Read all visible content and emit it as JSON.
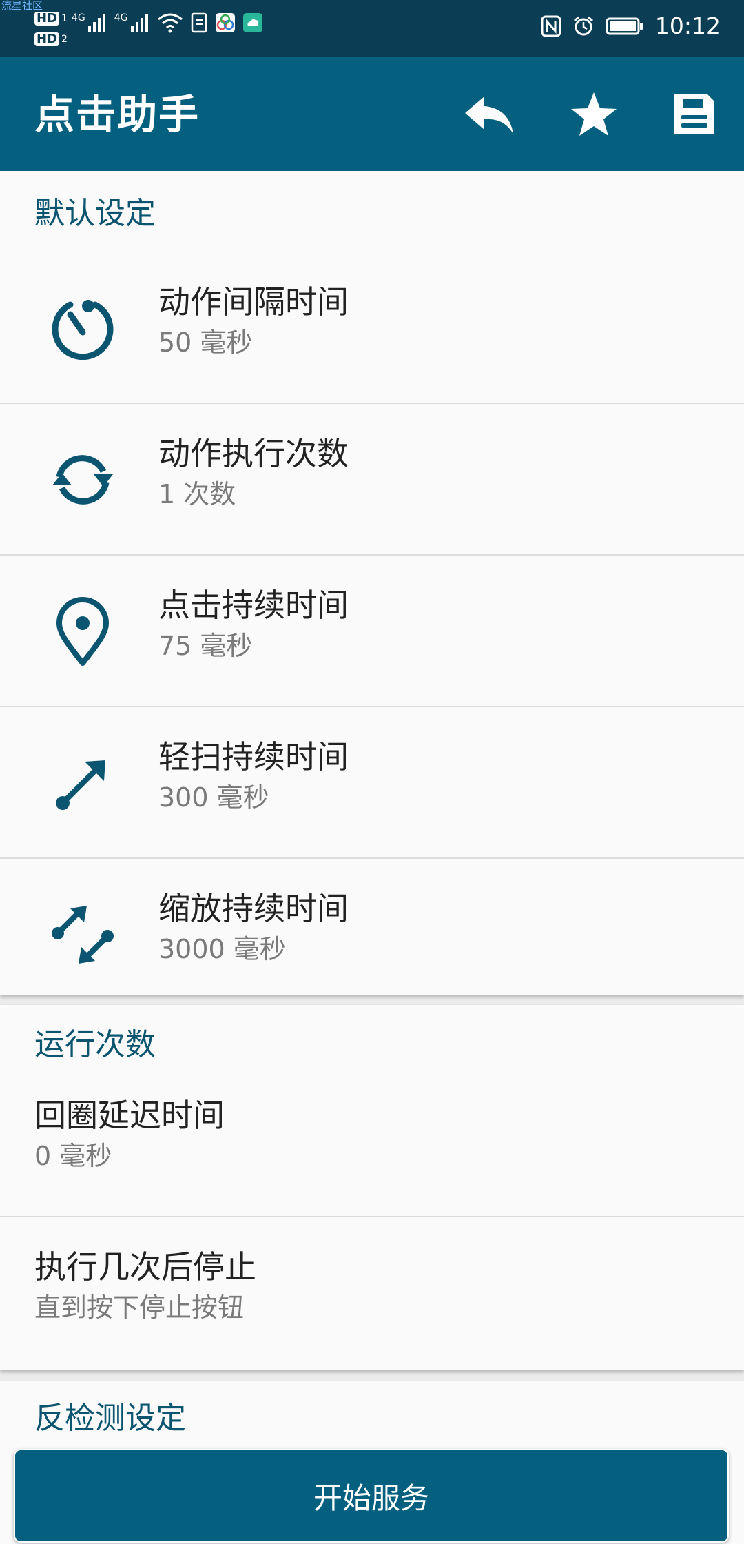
{
  "status_bar": {
    "watermark": "流星社区",
    "sim1": "HD",
    "sim1_index": "1",
    "sim2": "HD",
    "sim2_index": "2",
    "network1": "4G",
    "network2": "4G",
    "time": "10:12"
  },
  "app_bar": {
    "title": "点击助手"
  },
  "sections": {
    "default_settings": {
      "header": "默认设定",
      "items": [
        {
          "title": "动作间隔时间",
          "value": "50 毫秒"
        },
        {
          "title": "动作执行次数",
          "value": "1 次数"
        },
        {
          "title": "点击持续时间",
          "value": "75 毫秒"
        },
        {
          "title": "轻扫持续时间",
          "value": "300 毫秒"
        },
        {
          "title": "缩放持续时间",
          "value": "3000 毫秒"
        }
      ]
    },
    "run_count": {
      "header": "运行次数",
      "items": [
        {
          "title": "回圈延迟时间",
          "value": "0 毫秒"
        },
        {
          "title": "执行几次后停止",
          "value": "直到按下停止按钮"
        }
      ]
    },
    "anti_detect": {
      "header": "反检测设定"
    }
  },
  "start_button": {
    "label": "开始服务"
  },
  "colors": {
    "status_bar": "#0b3e55",
    "app_bar": "#05607f",
    "accent_icon": "#0b5571"
  }
}
